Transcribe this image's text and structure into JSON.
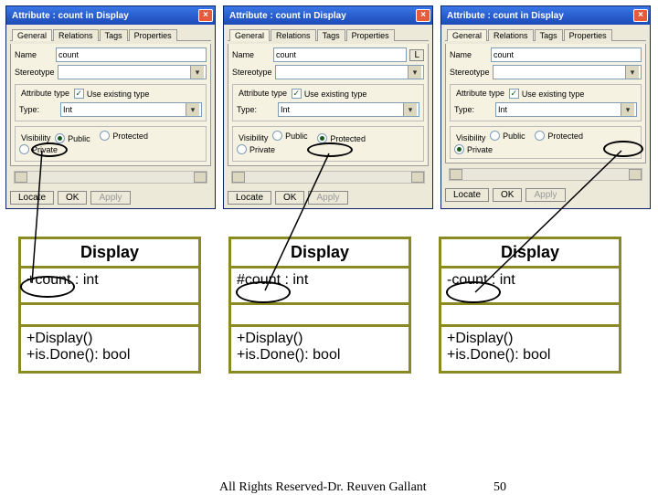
{
  "dialogs": [
    {
      "title": "Attribute : count in Display",
      "tabs": [
        "General",
        "Relations",
        "Tags",
        "Properties"
      ],
      "name_label": "Name",
      "name_value": "count",
      "stereo_label": "Stereotype",
      "stereo_value": "",
      "group_label": "Attribute type",
      "use_existing_label": "Use existing type",
      "type_label": "Type:",
      "type_value": "Int",
      "vis_label": "Visibility",
      "vis_opts": [
        "Public",
        "Protected",
        "Private"
      ],
      "vis_selected": "Public",
      "locate": "Locate",
      "ok": "OK",
      "apply": "Apply",
      "small_L": ""
    },
    {
      "title": "Attribute : count in Display",
      "tabs": [
        "General",
        "Relations",
        "Tags",
        "Properties"
      ],
      "name_label": "Name",
      "name_value": "count",
      "stereo_label": "Stereotype",
      "stereo_value": "",
      "group_label": "Attribute type",
      "use_existing_label": "Use existing type",
      "type_label": "Type:",
      "type_value": "Int",
      "vis_label": "Visibility",
      "vis_opts": [
        "Public",
        "Protected",
        "Private"
      ],
      "vis_selected": "Protected",
      "locate": "Locate",
      "ok": "OK",
      "apply": "Apply",
      "small_L": "L"
    },
    {
      "title": "Attribute : count in Display",
      "tabs": [
        "General",
        "Relations",
        "Tags",
        "Properties"
      ],
      "name_label": "Name",
      "name_value": "count",
      "stereo_label": "Stereotype",
      "stereo_value": "",
      "group_label": "Attribute type",
      "use_existing_label": "Use existing type",
      "type_label": "Type:",
      "type_value": "Int",
      "vis_label": "Visibility",
      "vis_opts": [
        "Public",
        "Protected",
        "Private"
      ],
      "vis_selected": "Private",
      "locate": "Locate",
      "ok": "OK",
      "apply": "Apply",
      "small_L": ""
    }
  ],
  "uml": [
    {
      "name": "Display",
      "attr": "+count : int",
      "ops": "+Display()\n+is.Done(): bool"
    },
    {
      "name": "Display",
      "attr": "#count : int",
      "ops": "+Display()\n+is.Done(): bool"
    },
    {
      "name": "Display",
      "attr": "-count : int",
      "ops": "+Display()\n+is.Done(): bool"
    }
  ],
  "footer": {
    "copy": "All Rights Reserved-Dr. Reuven Gallant",
    "page": "50"
  }
}
